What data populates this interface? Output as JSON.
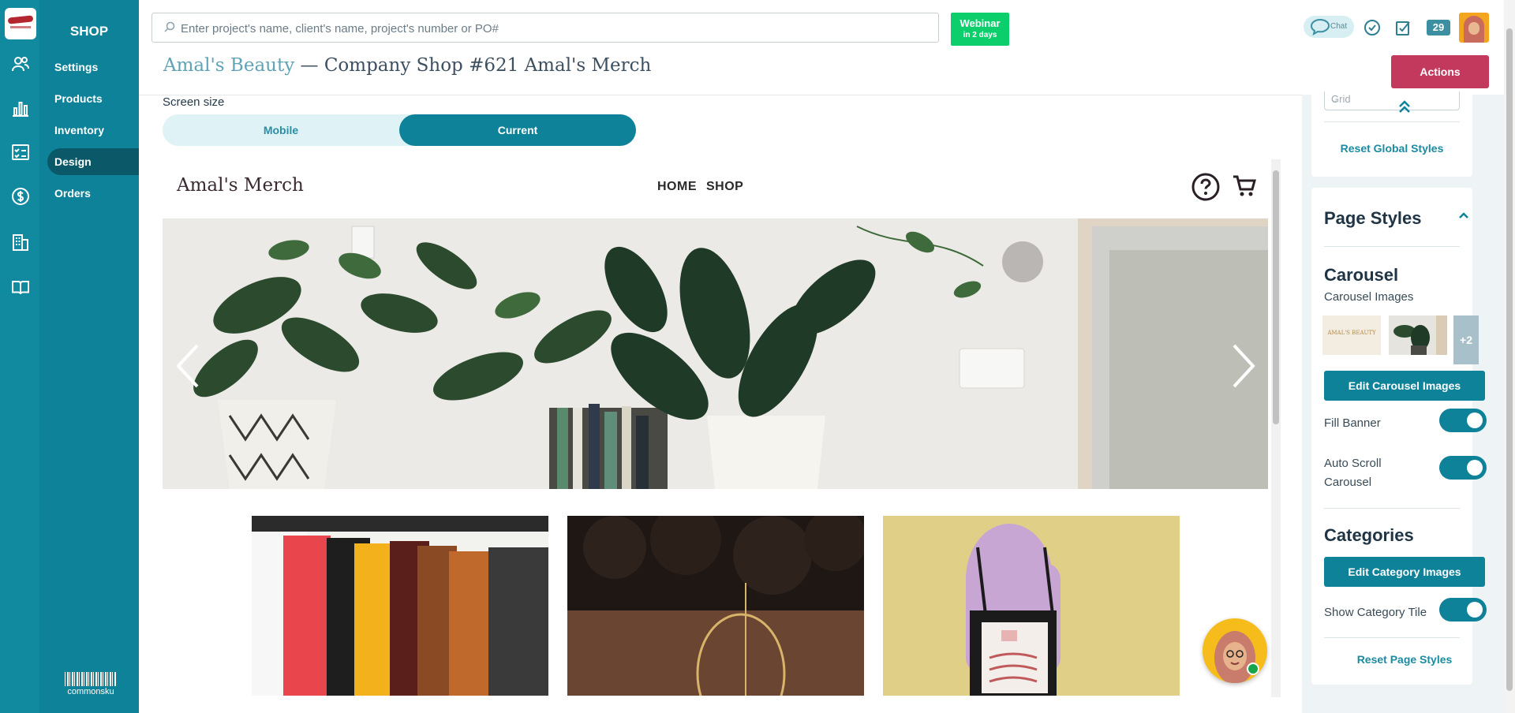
{
  "app": {
    "section_title": "SHOP",
    "footer_logo_text": "commonsku",
    "brand_logo": "Vandelay Industries"
  },
  "rail_icons": [
    "people-icon",
    "bar-chart-icon",
    "checklist-icon",
    "dollar-icon",
    "building-icon",
    "book-icon"
  ],
  "sidebar": {
    "items": [
      {
        "label": "Settings",
        "active": false
      },
      {
        "label": "Products",
        "active": false
      },
      {
        "label": "Inventory",
        "active": false
      },
      {
        "label": "Design",
        "active": true
      },
      {
        "label": "Orders",
        "active": false
      }
    ]
  },
  "topbar": {
    "search_placeholder": "Enter project's name, client's name, project's number or PO#",
    "webinar_label": "Webinar",
    "webinar_sub": "in 2 days",
    "chat_label": "Chat",
    "notification_count": "29",
    "accent_color": "#0d8299",
    "webinar_color": "#0ccf6c"
  },
  "header": {
    "client": "Amal's Beauty",
    "separator": " — ",
    "title": "Company Shop #621 Amal's Merch",
    "actions_label": "Actions",
    "actions_color": "#c2395d"
  },
  "screen_size": {
    "label": "Screen size",
    "options": [
      "Mobile",
      "Current"
    ],
    "selected": "Current"
  },
  "preview": {
    "store_name": "Amal's Merch",
    "nav": [
      "HOME",
      "SHOP"
    ],
    "category_tiles": [
      "clothing-rack-image",
      "earring-image",
      "tote-bag-image"
    ]
  },
  "panel": {
    "grid_select_value": "Grid",
    "reset_global": "Reset Global Styles",
    "page_styles_title": "Page Styles",
    "carousel_title": "Carousel",
    "carousel_images_label": "Carousel Images",
    "carousel_thumb_1_text": "AMAL'S BEAUTY",
    "carousel_more": "+2",
    "edit_carousel": "Edit Carousel Images",
    "fill_banner": "Fill Banner",
    "fill_banner_on": true,
    "auto_scroll": "Auto Scroll Carousel",
    "auto_scroll_on": true,
    "categories_title": "Categories",
    "edit_categories": "Edit Category Images",
    "show_category_tile": "Show Category Tile",
    "show_category_tile_on": true,
    "reset_page": "Reset Page Styles"
  }
}
